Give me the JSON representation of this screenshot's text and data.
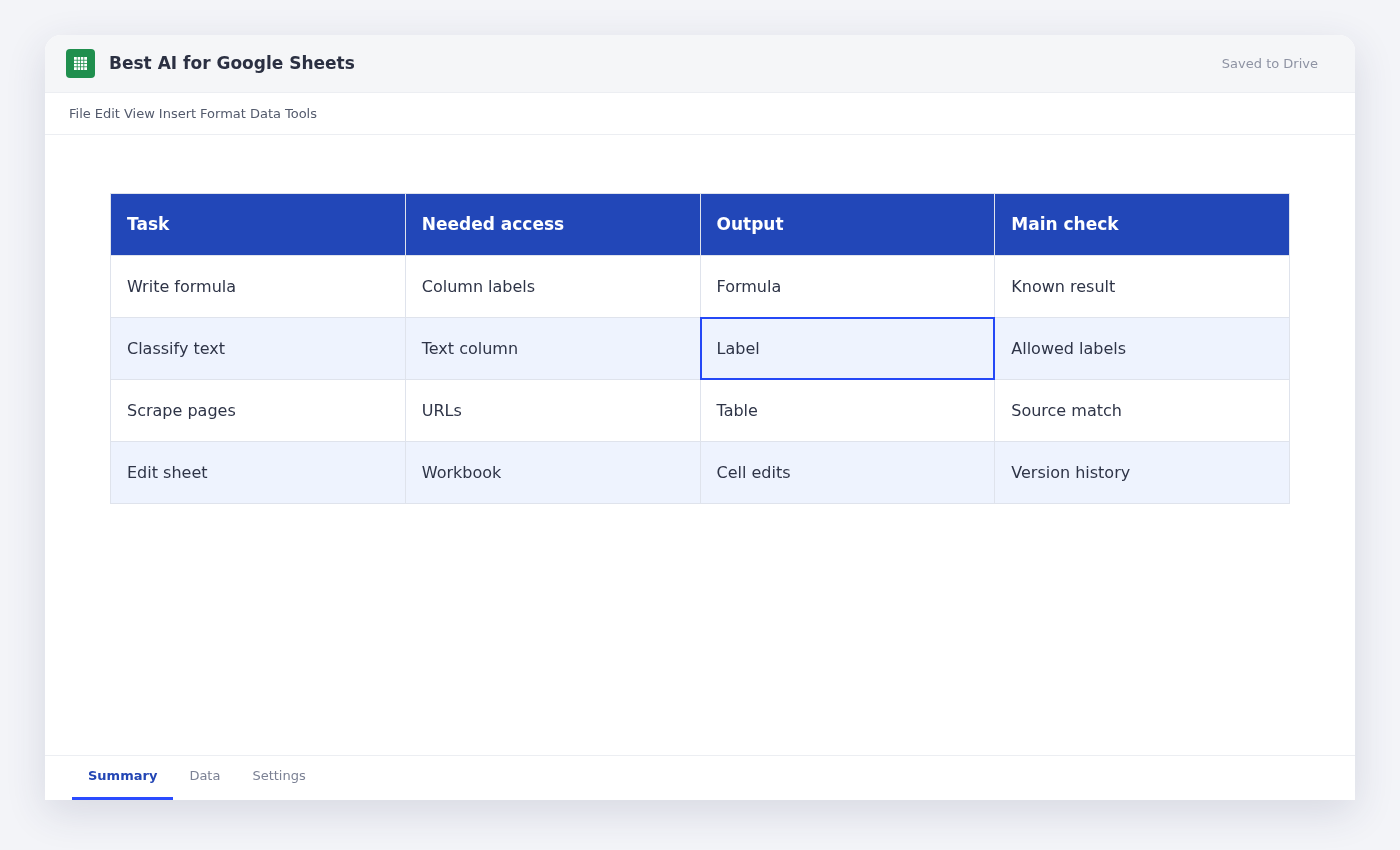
{
  "window": {
    "title": "Best AI for Google Sheets",
    "status": "Saved to Drive"
  },
  "menu": [
    "File",
    "Edit",
    "View",
    "Insert",
    "Format",
    "Data",
    "Tools"
  ],
  "table": {
    "columns": [
      "Task",
      "Needed access",
      "Output",
      "Main check"
    ],
    "rows": [
      [
        {
          "text": "Write formula",
          "selected": false
        },
        {
          "text": "Column labels",
          "selected": false
        },
        {
          "text": "Formula",
          "selected": false
        },
        {
          "text": "Known result",
          "selected": false
        }
      ],
      [
        {
          "text": "Classify text",
          "selected": false
        },
        {
          "text": "Text column",
          "selected": false
        },
        {
          "text": "Label",
          "selected": true
        },
        {
          "text": "Allowed labels",
          "selected": false
        }
      ],
      [
        {
          "text": "Scrape pages",
          "selected": false
        },
        {
          "text": "URLs",
          "selected": false
        },
        {
          "text": "Table",
          "selected": false
        },
        {
          "text": "Source match",
          "selected": false
        }
      ],
      [
        {
          "text": "Edit sheet",
          "selected": false
        },
        {
          "text": "Workbook",
          "selected": false
        },
        {
          "text": "Cell edits",
          "selected": false
        },
        {
          "text": "Version history",
          "selected": false
        }
      ]
    ]
  },
  "sheet_tabs": [
    {
      "label": "Summary",
      "selected": true
    },
    {
      "label": "Data",
      "selected": false
    },
    {
      "label": "Settings",
      "selected": false
    }
  ]
}
